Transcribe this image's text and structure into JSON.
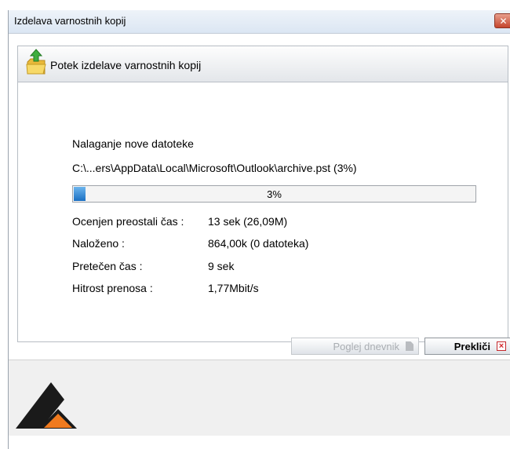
{
  "window": {
    "title": "Izdelava varnostnih kopij",
    "close_glyph": "✕"
  },
  "panel": {
    "title": "Potek izdelave varnostnih kopij",
    "status": "Nalaganje nove datoteke",
    "current_file": "C:\\...ers\\AppData\\Local\\Microsoft\\Outlook\\archive.pst (3%)",
    "progress": {
      "percent": 3,
      "label": "3%"
    },
    "details": [
      {
        "label": "Ocenjen preostali čas :",
        "value": "13 sek (26,09M)"
      },
      {
        "label": "Naloženo :",
        "value": "864,00k (0 datoteka)"
      },
      {
        "label": "Pretečen čas :",
        "value": "9 sek"
      },
      {
        "label": "Hitrost prenosa :",
        "value": "1,77Mbit/s"
      }
    ]
  },
  "buttons": {
    "view_log": "Poglej dnevnik",
    "cancel": "Prekliči"
  },
  "colors": {
    "progress_fill": "#1a6fc2",
    "logo_dark": "#1a1a1a",
    "logo_accent": "#f07a1e"
  }
}
